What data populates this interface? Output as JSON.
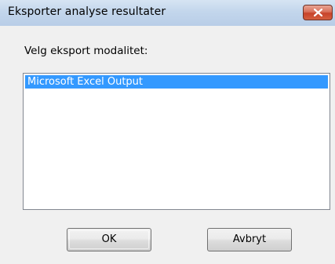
{
  "window": {
    "title": "Eksporter analyse resultater",
    "close_icon": "close-icon"
  },
  "prompt": {
    "label": "Velg eksport modalitet:"
  },
  "export_list": {
    "items": [
      {
        "label": "Microsoft Excel Output",
        "selected": true
      }
    ]
  },
  "buttons": {
    "ok_label": "OK",
    "cancel_label": "Avbryt"
  },
  "colors": {
    "selection": "#3399ff",
    "close_button": "#c7432a",
    "titlebar": "#c3d6ec"
  }
}
